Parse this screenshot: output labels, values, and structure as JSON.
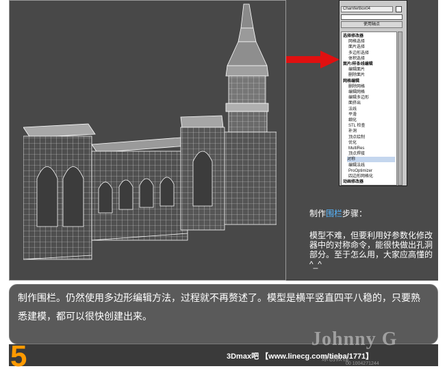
{
  "modifier_panel": {
    "object_name": "ChamferBox04",
    "pin_button": "使用轴点",
    "items": [
      {
        "label": "选择修改器",
        "type": "cat"
      },
      {
        "label": "网格选择",
        "type": "item"
      },
      {
        "label": "面片选择",
        "type": "item"
      },
      {
        "label": "多边形选择",
        "type": "item"
      },
      {
        "label": "体积选择",
        "type": "item"
      },
      {
        "label": "面片/样条线编辑",
        "type": "cat"
      },
      {
        "label": "编辑面片",
        "type": "item"
      },
      {
        "label": "删除面片",
        "type": "item"
      },
      {
        "label": "网格编辑",
        "type": "cat"
      },
      {
        "label": "删除网格",
        "type": "item"
      },
      {
        "label": "编辑网格",
        "type": "item"
      },
      {
        "label": "编辑多边形",
        "type": "item"
      },
      {
        "label": "面挤出",
        "type": "item"
      },
      {
        "label": "法线",
        "type": "item"
      },
      {
        "label": "平滑",
        "type": "item"
      },
      {
        "label": "细化",
        "type": "item"
      },
      {
        "label": "STL 检查",
        "type": "item"
      },
      {
        "label": "补洞",
        "type": "item"
      },
      {
        "label": "顶点绘制",
        "type": "item"
      },
      {
        "label": "优化",
        "type": "item"
      },
      {
        "label": "MultiRes",
        "type": "item"
      },
      {
        "label": "顶点焊接",
        "type": "item"
      },
      {
        "label": "对称",
        "type": "sel"
      },
      {
        "label": "编辑法线",
        "type": "item"
      },
      {
        "label": "ProOptimizer",
        "type": "item"
      },
      {
        "label": "四边形网格化",
        "type": "item"
      },
      {
        "label": "动画修改器",
        "type": "cat"
      }
    ]
  },
  "steps": {
    "prefix": "制作",
    "highlight": "围栏",
    "suffix": "步骤：",
    "description": "模型不难，但要利用好参数化修改器中的对称命令，能很快做出孔洞部分。至于怎么用，大家应高懂的^_^"
  },
  "caption": "制作围栏。仍然使用多边形编辑方法，过程就不再赘述了。模型是横平竖直四平八稳的，只要熟悉建模，都可以很快创建出来。",
  "footer": {
    "step_number": "5",
    "credit": "3Dmax吧 【www.linecg.com/tieba/1771】"
  },
  "watermark": {
    "name": "Johnny G",
    "sub": "原创教程",
    "number": "00 1004271244"
  },
  "colors": {
    "highlight": "#57b6ff",
    "step_number": "#ff9a00",
    "arrow": "#e01010"
  }
}
